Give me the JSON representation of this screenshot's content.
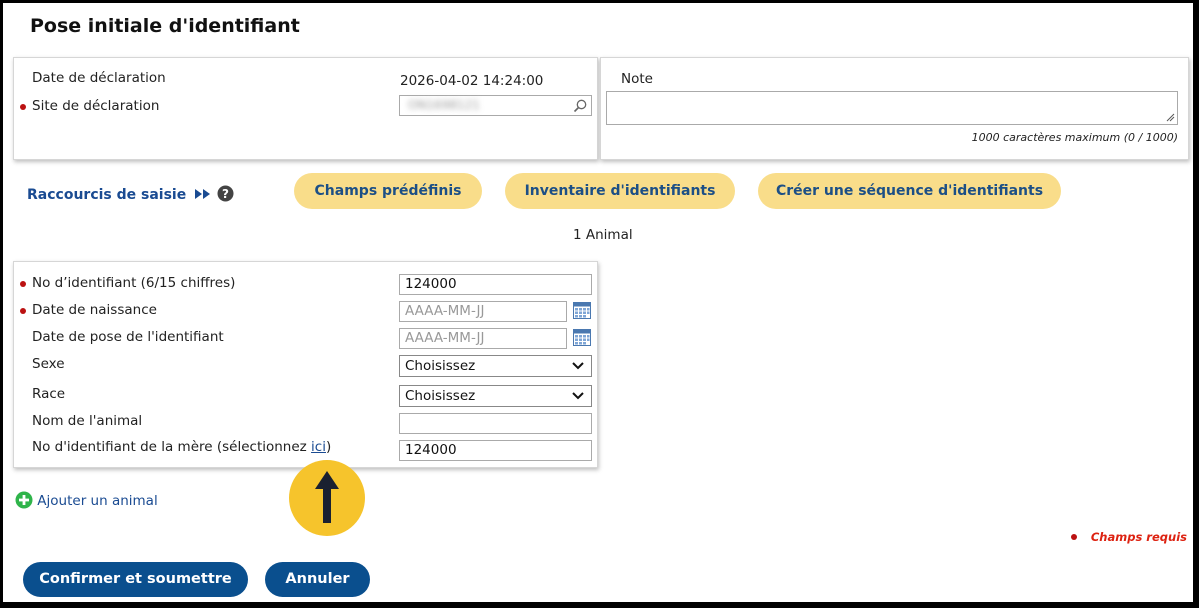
{
  "page": {
    "title": "Pose initiale d'identifiant"
  },
  "declaration": {
    "date_label": "Date de déclaration",
    "date_value": "2026-04-02 14:24:00",
    "site_label": "Site de déclaration",
    "site_value": "ON1698121"
  },
  "note": {
    "label": "Note",
    "value": "",
    "counter": "1000 caractères maximum (0 / 1000)"
  },
  "shortcuts": {
    "label": "Raccourcis de saisie",
    "buttons": [
      "Champs prédéfinis",
      "Inventaire d'identifiants",
      "Créer une séquence d'identifiants"
    ]
  },
  "animal_count": "1 Animal",
  "animal_form": {
    "id_label": "No d’identifiant (6/15 chiffres)",
    "id_value": "124000",
    "birth_label": "Date de naissance",
    "birth_placeholder": "AAAA-MM-JJ",
    "pose_label": "Date de pose de l'identifiant",
    "pose_placeholder": "AAAA-MM-JJ",
    "sex_label": "Sexe",
    "sex_value": "Choisissez",
    "breed_label": "Race",
    "breed_value": "Choisissez",
    "name_label": "Nom de l'animal",
    "name_value": "",
    "mother_label_prefix": "No d'identifiant de la mère (sélectionnez ",
    "mother_link": "ici",
    "mother_label_suffix": ")",
    "mother_value": "124000"
  },
  "add_animal": "Ajouter un animal",
  "required_note": "Champs requis",
  "actions": {
    "confirm": "Confirmer et soumettre",
    "cancel": "Annuler"
  },
  "colors": {
    "required_dot": "#b11111",
    "pill_bg": "#f9dd8a",
    "primary_button": "#0a4f8e",
    "callout": "#f6c42c",
    "add_icon": "#2fb44a"
  },
  "icons": [
    "search-icon",
    "calendar-icon",
    "chevron-down-icon",
    "help-icon",
    "double-arrow-icon",
    "plus-circle-icon",
    "arrow-up-icon",
    "resize-icon"
  ]
}
